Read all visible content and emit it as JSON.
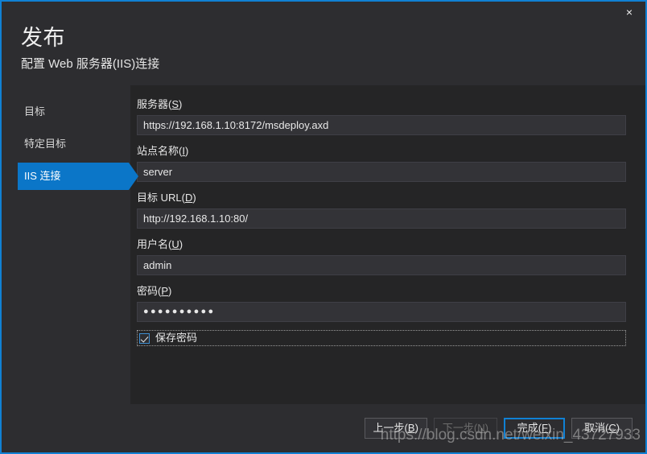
{
  "window": {
    "close_label": "×",
    "accent_color": "#1081d4"
  },
  "header": {
    "title": "发布",
    "subtitle": "配置 Web 服务器(IIS)连接"
  },
  "sidebar": {
    "items": [
      {
        "label": "目标",
        "active": false
      },
      {
        "label": "特定目标",
        "active": false
      },
      {
        "label": "IIS 连接",
        "active": true
      }
    ],
    "active_color": "#0b76c8"
  },
  "form": {
    "fields": [
      {
        "label_text": "服务器",
        "accel": "S",
        "value": "https://192.168.1.10:8172/msdeploy.axd",
        "placeholder": ""
      },
      {
        "label_text": "站点名称",
        "accel": "I",
        "value": "server",
        "placeholder": ""
      },
      {
        "label_text": "目标 URL",
        "accel": "D",
        "value": "http://192.168.1.10:80/",
        "placeholder": ""
      },
      {
        "label_text": "用户名",
        "accel": "U",
        "value": "admin",
        "placeholder": ""
      }
    ],
    "password": {
      "label_text": "密码",
      "accel": "P",
      "masked_value": "●●●●●●●●●●"
    },
    "save_password": {
      "label": "保存密码",
      "checked": true
    }
  },
  "footer": {
    "buttons": [
      {
        "text": "上一步",
        "accel": "B",
        "state": "normal"
      },
      {
        "text": "下一步",
        "accel": "N",
        "state": "disabled"
      },
      {
        "text": "完成",
        "accel": "F",
        "state": "default"
      },
      {
        "text": "取消",
        "accel": "C",
        "state": "normal"
      }
    ]
  },
  "watermark": {
    "text": "https://blog.csdn.net/weixin_43727933"
  }
}
